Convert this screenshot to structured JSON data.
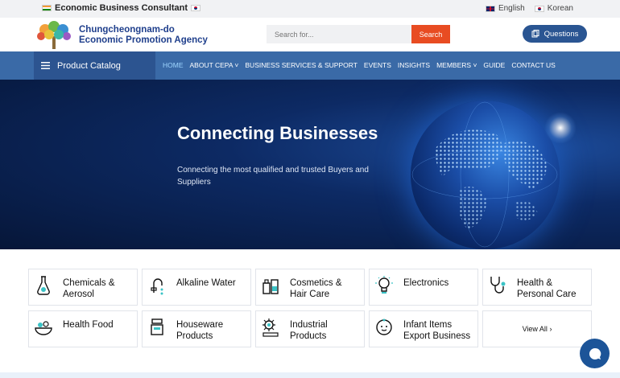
{
  "topbar": {
    "title": "Economic Business Consultant",
    "languages": [
      "English",
      "Korean"
    ]
  },
  "header": {
    "org_line1": "Chungcheongnam-do",
    "org_line2": "Economic Promotion Agency",
    "search_placeholder": "Search for...",
    "search_button": "Search",
    "questions_button": "Questions"
  },
  "nav": {
    "catalog": "Product Catalog",
    "items": [
      "HOME",
      "ABOUT CEPA",
      "BUSINESS SERVICES & SUPPORT",
      "EVENTS",
      "INSIGHTS",
      "MEMBERS",
      "GUIDE",
      "CONTACT US"
    ]
  },
  "hero": {
    "title": "Connecting Businesses",
    "subtitle": "Connecting the most qualified and trusted Buyers and Suppliers"
  },
  "categories": [
    {
      "line1": "Chemicals &",
      "line2": "Aerosol",
      "icon": "flask-icon"
    },
    {
      "line1": "Alkaline Water",
      "line2": "",
      "icon": "water-tap-icon"
    },
    {
      "line1": "Cosmetics &",
      "line2": "Hair Care",
      "icon": "cosmetics-icon"
    },
    {
      "line1": "Electronics",
      "line2": "",
      "icon": "lightbulb-icon"
    },
    {
      "line1": "Health &",
      "line2": "Personal Care",
      "icon": "stethoscope-icon"
    },
    {
      "line1": "Health Food",
      "line2": "",
      "icon": "food-bowl-icon"
    },
    {
      "line1": "Houseware",
      "line2": "Products",
      "icon": "pot-icon"
    },
    {
      "line1": "Industrial",
      "line2": "Products",
      "icon": "gear-icon"
    },
    {
      "line1": "Infant Items",
      "line2": "Export Business",
      "icon": "baby-icon"
    }
  ],
  "view_all": "View All",
  "colors": {
    "accent": "#e84c22",
    "nav": "#3a6aa7",
    "brand": "#2a5592"
  }
}
